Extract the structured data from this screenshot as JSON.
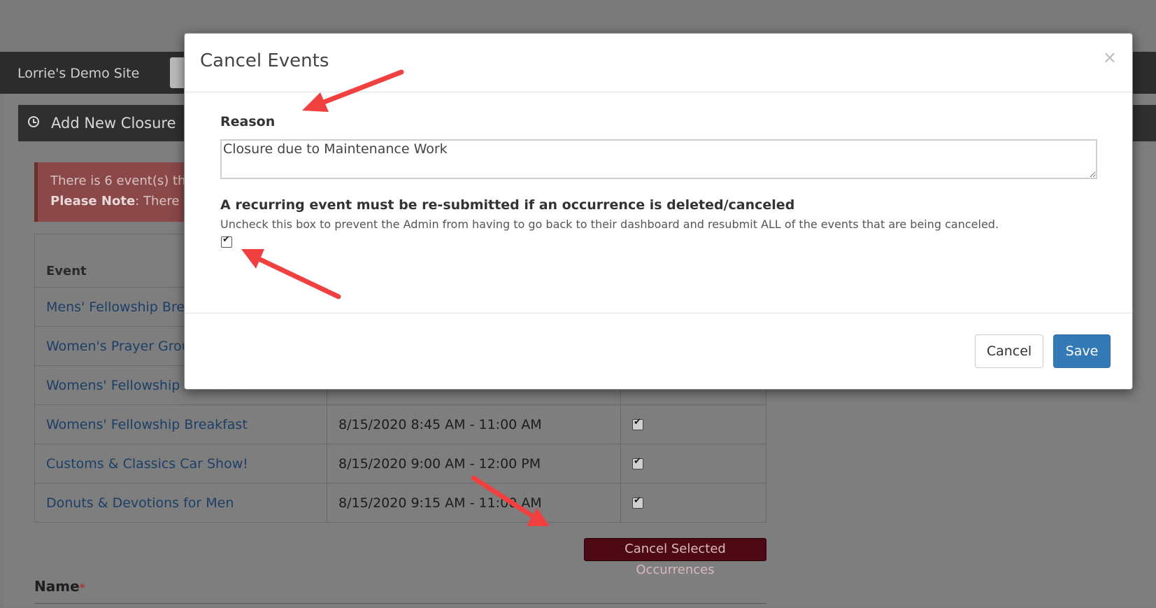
{
  "site": {
    "name": "Lorrie's Demo Site"
  },
  "panel": {
    "title": "Add New Closure"
  },
  "alert": {
    "line1": "There is 6 event(s) th",
    "line2_bold": "Please Note",
    "line2_rest": ": There a"
  },
  "table": {
    "header_event": "Event",
    "rows": [
      {
        "event": "Mens' Fellowship Brea",
        "date": "",
        "checked": true
      },
      {
        "event": "Women's Prayer Grou",
        "date": "",
        "checked": true
      },
      {
        "event": "Womens' Fellowship Breakfast",
        "date": "",
        "checked": true
      },
      {
        "event": "Womens' Fellowship Breakfast",
        "date": "8/15/2020 8:45 AM - 11:00 AM",
        "checked": true
      },
      {
        "event": "Customs & Classics Car Show!",
        "date": "8/15/2020 9:00 AM - 12:00 PM",
        "checked": true
      },
      {
        "event": "Donuts & Devotions for Men",
        "date": "8/15/2020 9:15 AM - 11:00 AM",
        "checked": true
      }
    ]
  },
  "cancel_occurrences_label": "Cancel Selected Occurrences",
  "name_field": {
    "label": "Name",
    "required_mark": "*"
  },
  "modal": {
    "title": "Cancel Events",
    "close_symbol": "×",
    "reason_label": "Reason",
    "reason_value": "Closure due to Maintenance Work",
    "recurring_label": "A recurring event must be re-submitted if an occurrence is deleted/canceled",
    "recurring_help": "Uncheck this box to prevent the Admin from having to go back to their dashboard and resubmit ALL of the events that are being canceled.",
    "recurring_checked": true,
    "cancel_label": "Cancel",
    "save_label": "Save"
  },
  "colors": {
    "annotation_arrow": "#f04040",
    "save_button": "#337ab7",
    "cancel_occurrences_button": "#4e0a14"
  }
}
